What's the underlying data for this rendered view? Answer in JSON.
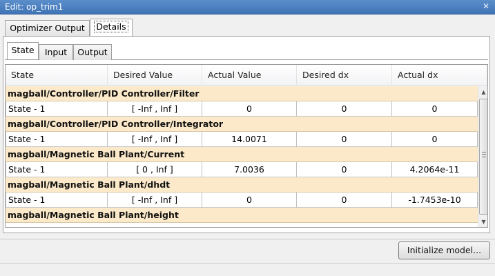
{
  "window": {
    "title": "Edit: op_trim1",
    "close_glyph": "✕"
  },
  "outer_tabs": [
    {
      "label": "Optimizer Output",
      "active": false
    },
    {
      "label": "Details",
      "active": true
    }
  ],
  "inner_tabs": [
    {
      "label": "State",
      "active": true
    },
    {
      "label": "Input",
      "active": false
    },
    {
      "label": "Output",
      "active": false
    }
  ],
  "table": {
    "headers": [
      "State",
      "Desired Value",
      "Actual Value",
      "Desired dx",
      "Actual dx"
    ],
    "groups": [
      {
        "name": "magball/Controller/PID Controller/Filter",
        "rows": [
          [
            "State - 1",
            "[ -Inf , Inf ]",
            "0",
            "0",
            "0"
          ]
        ]
      },
      {
        "name": "magball/Controller/PID Controller/Integrator",
        "rows": [
          [
            "State - 1",
            "[ -Inf , Inf ]",
            "14.0071",
            "0",
            "0"
          ]
        ]
      },
      {
        "name": "magball/Magnetic Ball Plant/Current",
        "rows": [
          [
            "State - 1",
            "[ 0 , Inf ]",
            "7.0036",
            "0",
            "4.2064e-11"
          ]
        ]
      },
      {
        "name": "magball/Magnetic Ball Plant/dhdt",
        "rows": [
          [
            "State - 1",
            "[ -Inf , Inf ]",
            "0",
            "0",
            "-1.7453e-10"
          ]
        ]
      },
      {
        "name": "magball/Magnetic Ball Plant/height",
        "rows": []
      }
    ]
  },
  "buttons": {
    "initialize": "Initialize model..."
  },
  "colors": {
    "group_row": "#fbe9c9",
    "titlebar": "#4a80c0"
  }
}
